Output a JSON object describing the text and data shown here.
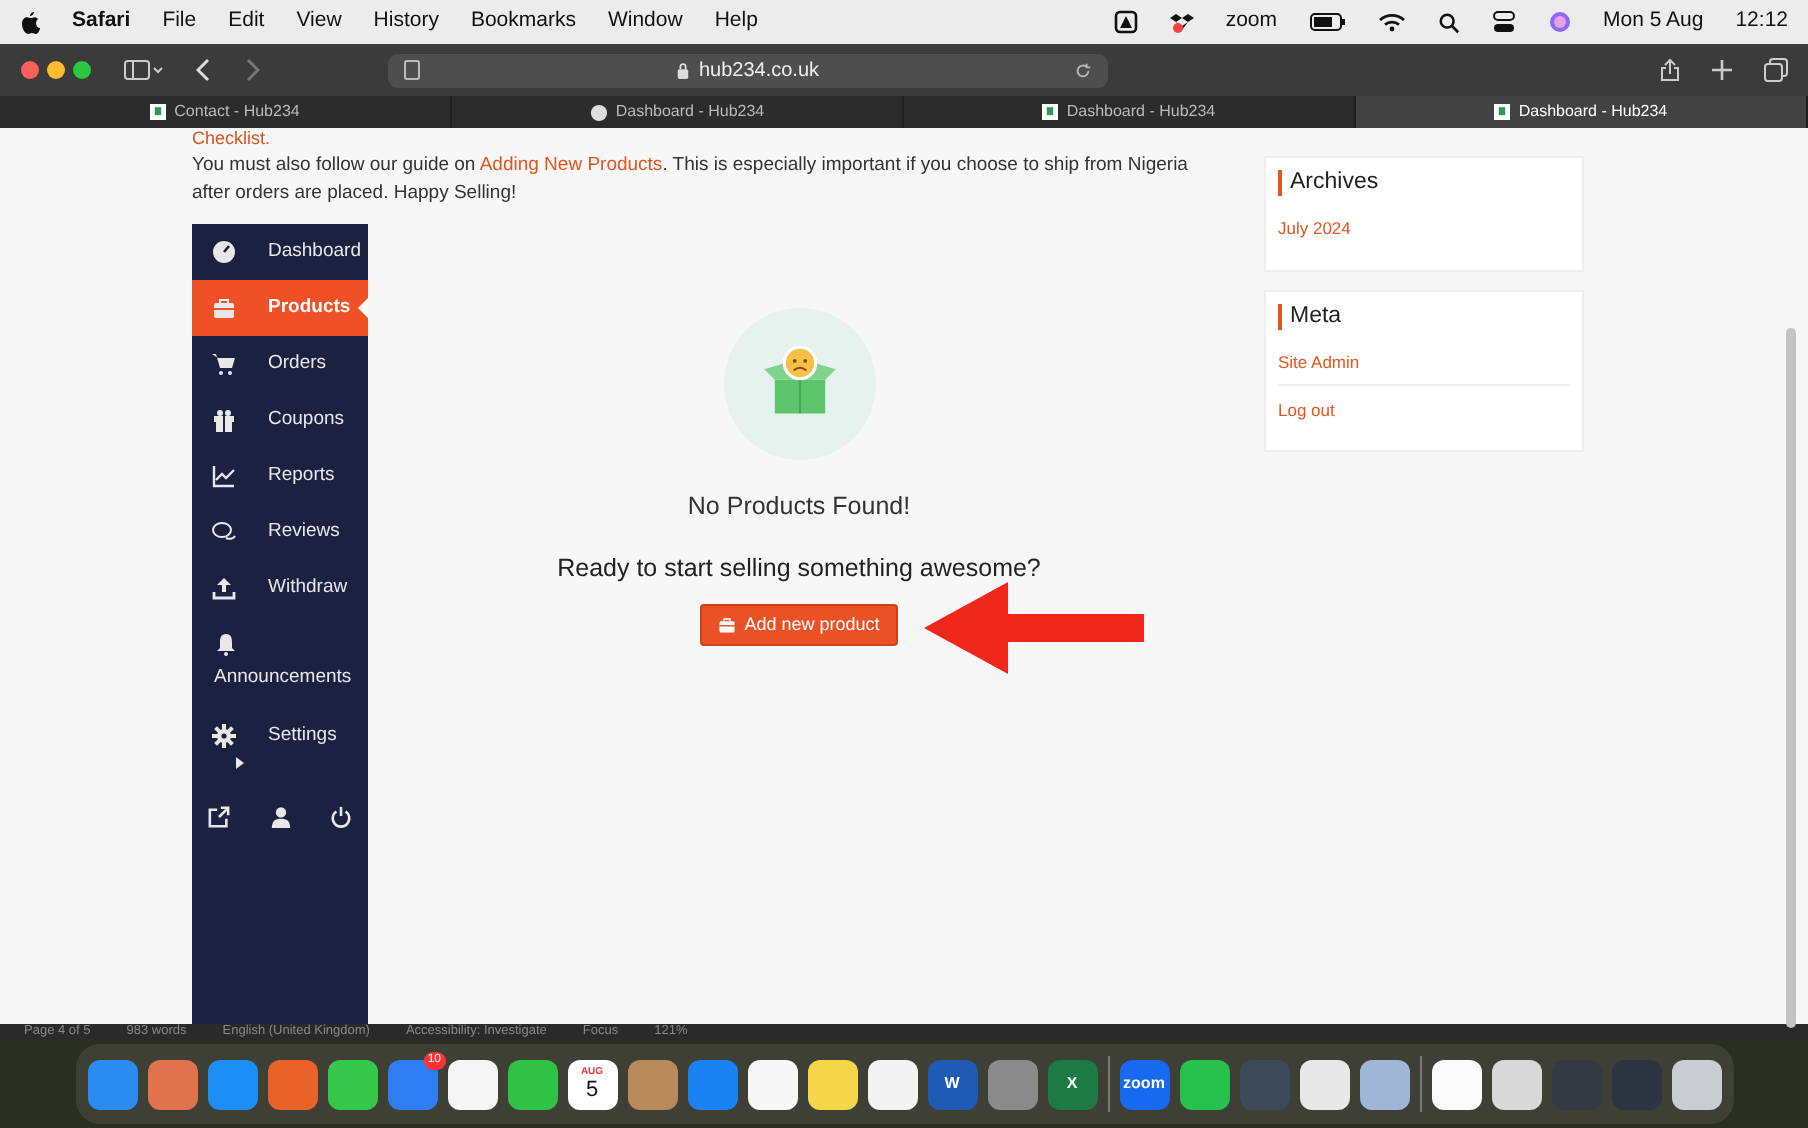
{
  "menu_bar": {
    "app": "Safari",
    "menus": [
      "File",
      "Edit",
      "View",
      "History",
      "Bookmarks",
      "Window",
      "Help"
    ],
    "status_text": "zoom",
    "date": "Mon 5 Aug",
    "time": "12:12"
  },
  "browser": {
    "address": "hub234.co.uk",
    "tabs": [
      {
        "label": "Contact - Hub234",
        "selected": false,
        "kind": "site"
      },
      {
        "label": "Dashboard - Hub234",
        "selected": false,
        "kind": "wordpress"
      },
      {
        "label": "Dashboard - Hub234",
        "selected": false,
        "kind": "site"
      },
      {
        "label": "Dashboard - Hub234",
        "selected": true,
        "kind": "site"
      }
    ]
  },
  "page": {
    "checklist_link": "Checklist.",
    "notice": {
      "before": "You must also follow our guide on ",
      "link": "Adding New Products",
      "after": ". This is especially important if you choose to ship from Nigeria after orders are placed. Happy Selling!"
    },
    "sidebar": {
      "items": [
        {
          "label": "Dashboard",
          "selected": false
        },
        {
          "label": "Products",
          "selected": true
        },
        {
          "label": "Orders",
          "selected": false
        },
        {
          "label": "Coupons",
          "selected": false
        },
        {
          "label": "Reports",
          "selected": false
        },
        {
          "label": "Reviews",
          "selected": false
        },
        {
          "label": "Withdraw",
          "selected": false
        },
        {
          "label": "Announcements",
          "selected": false
        },
        {
          "label": "Settings",
          "selected": false
        }
      ]
    },
    "empty_state": {
      "title": "No Products Found!",
      "subtitle": "Ready to start selling something awesome?",
      "button": "Add new product"
    },
    "widgets": [
      {
        "title": "Archives",
        "links": [
          "July 2024"
        ]
      },
      {
        "title": "Meta",
        "links": [
          "Site Admin",
          "Log out"
        ]
      }
    ]
  },
  "background_status_bar": [
    "Page 4 of 5",
    "983 words",
    "English (United Kingdom)",
    "Accessibility: Investigate",
    "Focus",
    "121%"
  ],
  "dock": [
    {
      "kind": "app",
      "color": "#2a8cf0"
    },
    {
      "kind": "app",
      "color": "#e0734c"
    },
    {
      "kind": "app",
      "color": "#1d8ef5"
    },
    {
      "kind": "app",
      "color": "#e9622a"
    },
    {
      "kind": "app",
      "color": "#36c84b"
    },
    {
      "kind": "app",
      "color": "#2f7df2",
      "badge": "10"
    },
    {
      "kind": "app",
      "color": "#f5f5f5"
    },
    {
      "kind": "app",
      "color": "#2fc244"
    },
    {
      "kind": "calendar",
      "color": "#ffffff",
      "month": "AUG",
      "day": "5"
    },
    {
      "kind": "app",
      "color": "#b88a5a"
    },
    {
      "kind": "app",
      "color": "#1a83f3"
    },
    {
      "kind": "app",
      "color": "#f7f7f7"
    },
    {
      "kind": "app",
      "color": "#f5d64a"
    },
    {
      "kind": "app",
      "color": "#f3f3f3"
    },
    {
      "kind": "app",
      "color": "#1f5bb5",
      "text": "W"
    },
    {
      "kind": "app",
      "color": "#8b8b8b"
    },
    {
      "kind": "app",
      "color": "#1e7a44",
      "text": "X"
    },
    {
      "kind": "separator"
    },
    {
      "kind": "app",
      "color": "#1769f0",
      "text": "zoom"
    },
    {
      "kind": "app",
      "color": "#27c14e"
    },
    {
      "kind": "app",
      "color": "#3d4a5a"
    },
    {
      "kind": "app",
      "color": "#e8e8e8"
    },
    {
      "kind": "app",
      "color": "#9fb6d6"
    },
    {
      "kind": "separator"
    },
    {
      "kind": "app",
      "color": "#fafafa"
    },
    {
      "kind": "app",
      "color": "#d8d8d8"
    },
    {
      "kind": "app",
      "color": "#333a44"
    },
    {
      "kind": "app",
      "color": "#2b3440"
    },
    {
      "kind": "app",
      "color": "#c8cdd2"
    }
  ]
}
